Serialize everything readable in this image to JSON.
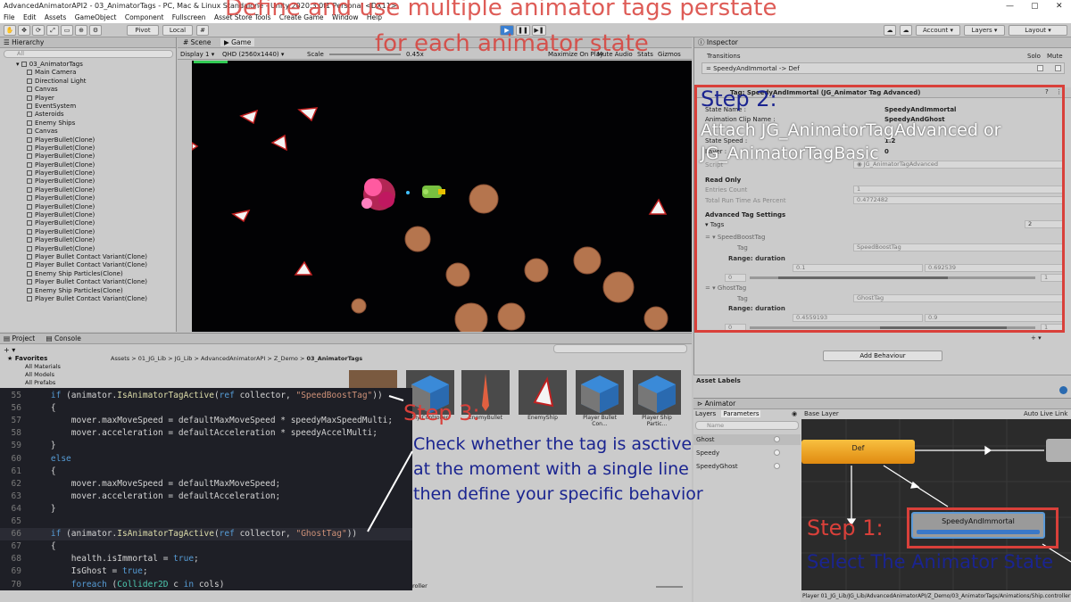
{
  "window": {
    "title": "AdvancedAnimatorAPI2 - 03_AnimatorTags - PC, Mac & Linux Standalone - Unity 2020.3.0f1 Personal <DX11>",
    "controls": [
      "—",
      "▢",
      "✕"
    ]
  },
  "menu": [
    "File",
    "Edit",
    "Assets",
    "GameObject",
    "Component",
    "Fullscreen",
    "Asset Store Tools",
    "Create Game",
    "Window",
    "Help"
  ],
  "toolbar": {
    "pivot": "Pivot",
    "local": "Local",
    "account": "Account",
    "layers": "Layers",
    "layout": "Layout"
  },
  "hierarchy": {
    "title": "Hierarchy",
    "search_placeholder": "All",
    "scene": "03_AnimatorTags",
    "items": [
      "Main Camera",
      "Directional Light",
      "Canvas",
      "Player",
      "EventSystem",
      "Asteroids",
      "Enemy Ships",
      "Canvas",
      "PlayerBullet(Clone)",
      "PlayerBullet(Clone)",
      "PlayerBullet(Clone)",
      "PlayerBullet(Clone)",
      "PlayerBullet(Clone)",
      "PlayerBullet(Clone)",
      "PlayerBullet(Clone)",
      "PlayerBullet(Clone)",
      "PlayerBullet(Clone)",
      "PlayerBullet(Clone)",
      "PlayerBullet(Clone)",
      "PlayerBullet(Clone)",
      "PlayerBullet(Clone)",
      "PlayerBullet(Clone)",
      "Player Bullet Contact Variant(Clone)",
      "Player Bullet Contact Variant(Clone)",
      "Enemy Ship Particles(Clone)",
      "Player Bullet Contact Variant(Clone)",
      "Enemy Ship Particles(Clone)",
      "Player Bullet Contact Variant(Clone)"
    ]
  },
  "gameview": {
    "tabs": [
      "Scene",
      "Game"
    ],
    "display": "Display 1",
    "resolution": "QHD (2560x1440)",
    "scale_label": "Scale",
    "scale_value": "0.45x",
    "options": [
      "Maximize On Play",
      "Mute Audio",
      "Stats",
      "Gizmos"
    ]
  },
  "project": {
    "tabs": [
      "Project",
      "Console"
    ],
    "favorites": "Favorites",
    "fav_items": [
      "All Materials",
      "All Models",
      "All Prefabs"
    ],
    "breadcrumb": [
      "Assets",
      "01_JG_Lib",
      "JG_Lib",
      "AdvancedAnimatorAPI",
      "Z_Demo",
      "03_AnimatorTags"
    ],
    "assets": [
      "My Controller",
      "EnemyBullet",
      "EnemyShip",
      "Player Bullet Con...",
      "Player Ship Partic..."
    ],
    "partial_label": "roller"
  },
  "code": {
    "lines": [
      {
        "n": "55",
        "c": "    if (animator.IsAnimatorTagActive(ref collector, \"SpeedBoostTag\"))"
      },
      {
        "n": "56",
        "c": "    {"
      },
      {
        "n": "57",
        "c": "        mover.maxMoveSpeed = defaultMaxMoveSpeed * speedyMaxSpeedMulti;"
      },
      {
        "n": "58",
        "c": "        mover.acceleration = defaultAcceleration * speedyAccelMulti;"
      },
      {
        "n": "59",
        "c": "    }"
      },
      {
        "n": "60",
        "c": "    else"
      },
      {
        "n": "61",
        "c": "    {"
      },
      {
        "n": "62",
        "c": "        mover.maxMoveSpeed = defaultMaxMoveSpeed;"
      },
      {
        "n": "63",
        "c": "        mover.acceleration = defaultAcceleration;"
      },
      {
        "n": "64",
        "c": "    }"
      },
      {
        "n": "65",
        "c": ""
      },
      {
        "n": "66",
        "c": "    if (animator.IsAnimatorTagActive(ref collector, \"GhostTag\"))"
      },
      {
        "n": "67",
        "c": "    {"
      },
      {
        "n": "68",
        "c": "        health.isImmortal = true;"
      },
      {
        "n": "69",
        "c": "        IsGhost = true;"
      },
      {
        "n": "70",
        "c": "        foreach (Collider2D c in cols)"
      }
    ]
  },
  "inspector": {
    "title": "Inspector",
    "transitions": "Transitions",
    "solo": "Solo",
    "mute": "Mute",
    "transition_item": "SpeedyAndImmortal -> Def",
    "component_title": "Tag: SpeedyAndImmortal (JG_Animator Tag Advanced)",
    "state_name_label": "State Name :",
    "state_name": "SpeedyAndImmortal",
    "clip_label": "Animation Clip Name :",
    "clip": "SpeedyAndGhost",
    "speed_label": "State Speed :",
    "speed": "1.2",
    "layer_label": "Layer :",
    "layer": "0",
    "script_label": "Script",
    "script": "JG_AnimatorTagAdvanced",
    "read_only": "Read Only",
    "entries_label": "Entries Count",
    "entries": "1",
    "runtime_label": "Total Run Time As Percent",
    "runtime": "0.4772482",
    "adv_settings": "Advanced Tag Settings",
    "tags_label": "Tags",
    "tags_count": "2",
    "tag1_header": "SpeedBoostTag",
    "tag_label": "Tag",
    "tag1": "SpeedBoostTag",
    "range_label": "Range: duration",
    "tag1_min": "0.1",
    "tag1_max": "0.692539",
    "range_lo": "0",
    "range_hi": "1",
    "tag2_header": "GhostTag",
    "tag2": "GhostTag",
    "tag2_min": "0.4559193",
    "tag2_max": "0.9",
    "add_behaviour": "Add Behaviour",
    "asset_labels": "Asset Labels"
  },
  "animator": {
    "title": "Animator",
    "tabs": [
      "Layers",
      "Parameters"
    ],
    "search_placeholder": "Name",
    "params": [
      "Ghost",
      "Speedy",
      "SpeedyGhost"
    ],
    "base_layer": "Base Layer",
    "auto_live": "Auto Live Link",
    "state_def": "Def",
    "state_speedy": "SpeedyAndImmortal",
    "path": "Player 01_JG_Lib/JG_Lib/AdvancedAnimatorAPI/Z_Demo/03_AnimatorTags/Animations/Ship.controller"
  },
  "overlays": {
    "title_line1": "Define and use multiple animator tags perstate",
    "title_line2": "for each animator state",
    "step2_title": "Step 2:",
    "step2_text1": "Attach JG_AnimatorTagAdvanced or",
    "step2_text2": "JG_AnimatorTagBasic",
    "step3_title": "Step 3:",
    "step3_text1": "Check whether the tag is asctive",
    "step3_text2": "at the moment with a single line",
    "step3_text3": "then define your specific behavior",
    "step1_title": "Step 1:",
    "step1_text": "Select The Animator State"
  },
  "colors": {
    "overlay_red": "#d9403a",
    "overlay_blue": "#1a2490",
    "state_orange": "#f0a020",
    "state_selected": "#3a78c8"
  }
}
